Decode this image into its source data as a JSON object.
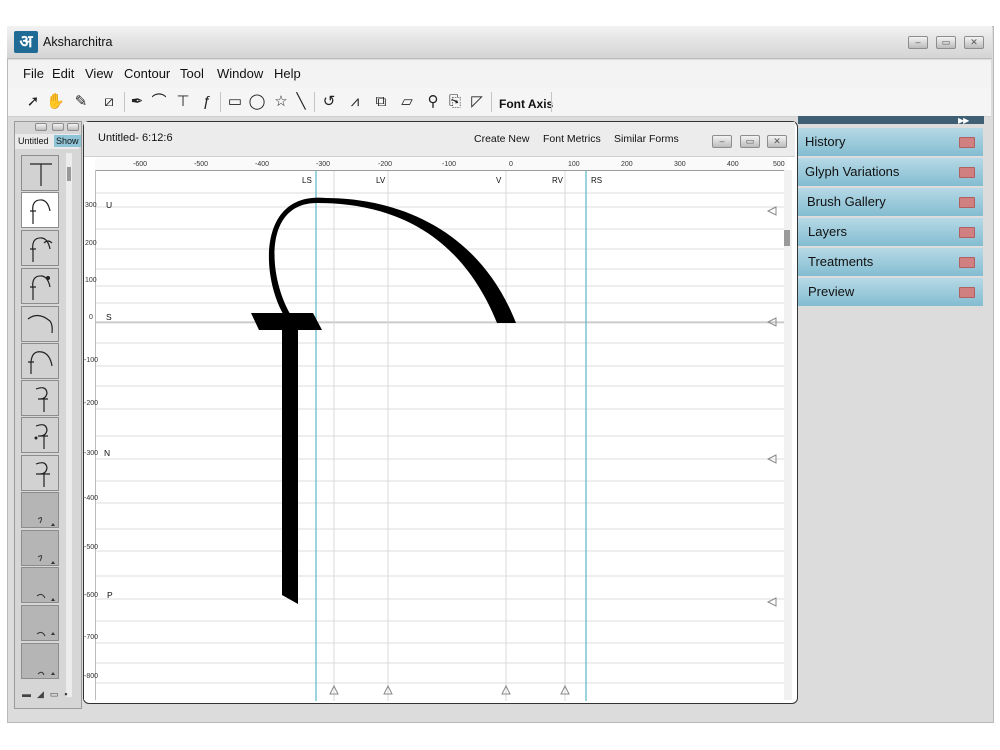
{
  "app": {
    "title": "Aksharchitra",
    "icon_glyph": "अ"
  },
  "menu": [
    "File",
    "Edit",
    "View",
    "Contour",
    "Tool",
    "Window",
    "Help"
  ],
  "toolbar": {
    "font_axis_label": "Font Axis"
  },
  "left_panel": {
    "tab_untitled": "Untitled",
    "tab_show": "Show"
  },
  "canvas_window": {
    "title": "Untitled- 6:12:6",
    "links": [
      "Create New",
      "Font Metrics",
      "Similar Forms"
    ]
  },
  "ruler_x": [
    "-600",
    "-500",
    "-400",
    "-300",
    "-200",
    "-100",
    "0",
    "100",
    "200",
    "300",
    "400",
    "500"
  ],
  "ruler_y": [
    "300",
    "200",
    "100",
    "0",
    "-100",
    "-200",
    "-300",
    "-400",
    "-500",
    "-600",
    "-700",
    "-800"
  ],
  "guides_v": [
    "LS",
    "LV",
    "V",
    "RV",
    "RS"
  ],
  "guides_h": [
    "U",
    "S",
    "N",
    "P"
  ],
  "right_panel": [
    "History",
    "Glyph Variations",
    "Brush Gallery",
    "Layers",
    "Treatments",
    "Preview"
  ],
  "colors": {
    "accent_panel": "#8fc3d6",
    "guide": "#5bb7c9",
    "glyph": "#000000"
  }
}
